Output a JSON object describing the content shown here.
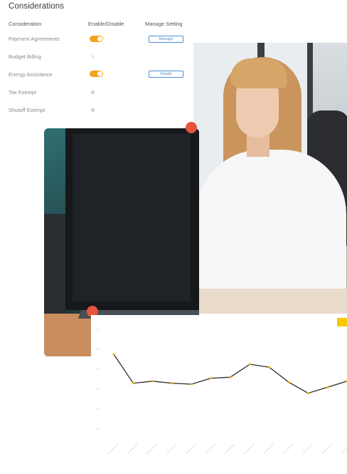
{
  "considerations": {
    "title": "Considerations",
    "columns": [
      "Consideration",
      "Enable/Disable",
      "Manage Setting"
    ],
    "rows": [
      {
        "label": "Payment Agreements",
        "enabled": true,
        "action": "Manage"
      },
      {
        "label": "Budget Billing",
        "enabled": false,
        "action": ""
      },
      {
        "label": "Energy Assistance",
        "enabled": true,
        "action": "Details"
      },
      {
        "label": "Tax Exempt",
        "enabled": false,
        "action": ""
      },
      {
        "label": "Shutoff Exempt",
        "enabled": false,
        "action": ""
      }
    ]
  },
  "colors": {
    "toggle_on": "#f4a21a",
    "button_border": "#4a8fd6",
    "accent_dot": "#e8533e",
    "chart_line": "#2b2b2b",
    "chart_point": "#e6b800",
    "badge": "#f5c800"
  },
  "icons": [
    "toggle-on-icon",
    "toggle-off-icon"
  ],
  "chart_data": {
    "type": "line",
    "series": [
      {
        "values": [
          7.5,
          4.6,
          4.8,
          4.6,
          4.5,
          5.1,
          5.2,
          6.5,
          6.2,
          4.7,
          3.6,
          4.2,
          4.8
        ]
      }
    ]
  }
}
